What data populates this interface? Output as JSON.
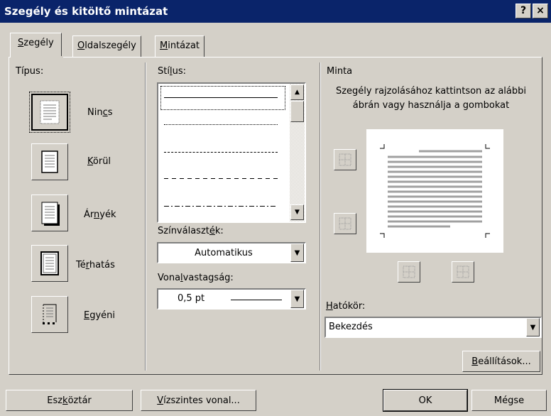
{
  "window": {
    "title": "Szegély és kitöltő mintázat",
    "help_label": "?",
    "close_label": "×"
  },
  "tabs": [
    {
      "before": "",
      "key": "S",
      "after": "zegély"
    },
    {
      "before": "",
      "key": "O",
      "after": "ldalszegély"
    },
    {
      "before": "",
      "key": "M",
      "after": "intázat"
    }
  ],
  "type_section": {
    "label": "Típus:",
    "options": [
      {
        "before": "Nin",
        "key": "c",
        "after": "s"
      },
      {
        "before": "",
        "key": "K",
        "after": "örül"
      },
      {
        "before": "Ár",
        "key": "n",
        "after": "yék"
      },
      {
        "before": "Té",
        "key": "r",
        "after": "hatás"
      },
      {
        "before": "",
        "key": "E",
        "after": "gyéni"
      }
    ]
  },
  "style_section": {
    "label": {
      "before": "Stí",
      "key": "l",
      "after": "us:"
    },
    "line_styles": [
      "solid",
      "dotted",
      "dashed-fine",
      "dashed",
      "dash-dot"
    ],
    "selected": "solid"
  },
  "color_section": {
    "label": {
      "before": "Színválaszt",
      "key": "é",
      "after": "k:"
    },
    "value": "Automatikus"
  },
  "width_section": {
    "label": {
      "before": "Vona",
      "key": "l",
      "after": "vastagság:"
    },
    "value": "0,5 pt"
  },
  "preview_section": {
    "label": "Minta",
    "hint_line1": "Szegély rajzolásához kattintson az alábbi",
    "hint_line2": "ábrán vagy használja a gombokat"
  },
  "apply_section": {
    "label": {
      "before": "",
      "key": "H",
      "after": "atókör:"
    },
    "value": "Bekezdés"
  },
  "buttons": {
    "options": {
      "before": "",
      "key": "B",
      "after": "eállítások..."
    },
    "toolbar": {
      "before": "Esz",
      "key": "k",
      "after": "öztár"
    },
    "horizontal_line": {
      "before": "",
      "key": "V",
      "after": "ízszintes vonal..."
    },
    "ok": "OK",
    "cancel": "Mégse"
  },
  "colors": {
    "title_bar": "#0a246a",
    "face": "#d4d0c8"
  }
}
